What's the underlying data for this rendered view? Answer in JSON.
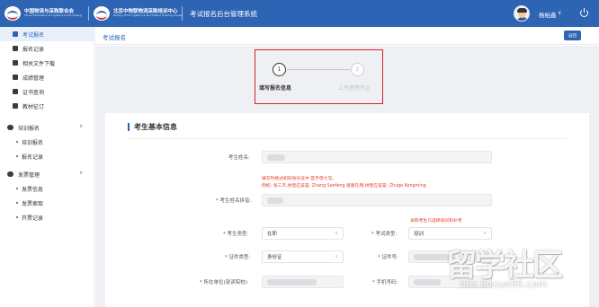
{
  "header": {
    "logo1_cn": "中国物流与采购联合会",
    "logo1_en": "China Federation of Logistics & Purchasing",
    "logo2_cn": "北京中物联物流采购培训中心",
    "logo2_en": "Beijing CFLP Logistics & Purchasing Training Center",
    "system_title": "考试报名后台管理系统",
    "username": "杨柏鑫",
    "caret": "∨"
  },
  "sidebar": {
    "items": [
      {
        "label": "考试报名",
        "active": true
      },
      {
        "label": "报名记录"
      },
      {
        "label": "相关文件下载"
      },
      {
        "label": "成绩管理"
      },
      {
        "label": "证书查询"
      },
      {
        "label": "教材征订"
      }
    ],
    "groups": [
      {
        "label": "培训报名",
        "chevron": "∧",
        "subitems": [
          "培训报名",
          "报名记录"
        ]
      },
      {
        "label": "发票管理",
        "chevron": "∧",
        "subitems": [
          "发票信息",
          "发票索取",
          "开票记录"
        ]
      }
    ]
  },
  "breadcrumb": "考试报名",
  "return_button": "返回",
  "steps": [
    {
      "number": "1",
      "label": "填写报名信息"
    },
    {
      "number": "2",
      "label": "上传缴费凭证"
    }
  ],
  "form": {
    "section_title": "考生基本信息",
    "name_label": "考生姓名:",
    "pinyin_hint_line1": "填写时格式如同身份证中  首字母大写。",
    "pinyin_hint_line2": "例如: 张三丰,拼音应该是: Zhang Sanfeng,诸葛孔明,拼音应该是: Zhuge Kongming",
    "pinyin_label": "* 考生姓名拼音:",
    "exam_type_hint": "采购考生只选择培训和补考",
    "candidate_type_label": "* 考生类型:",
    "candidate_type_value": "在职",
    "exam_type_label": "* 考试类型:",
    "exam_type_value": "培训",
    "id_type_label": "* 证件类型:",
    "id_type_value": "身份证",
    "id_number_label": "* 证件号:",
    "employer_label": "* 所在单位(就读院校):",
    "phone_label": "* 手机号码:"
  },
  "watermark": {
    "text": "留学社区",
    "url": "bbs.liuxue86.com"
  }
}
